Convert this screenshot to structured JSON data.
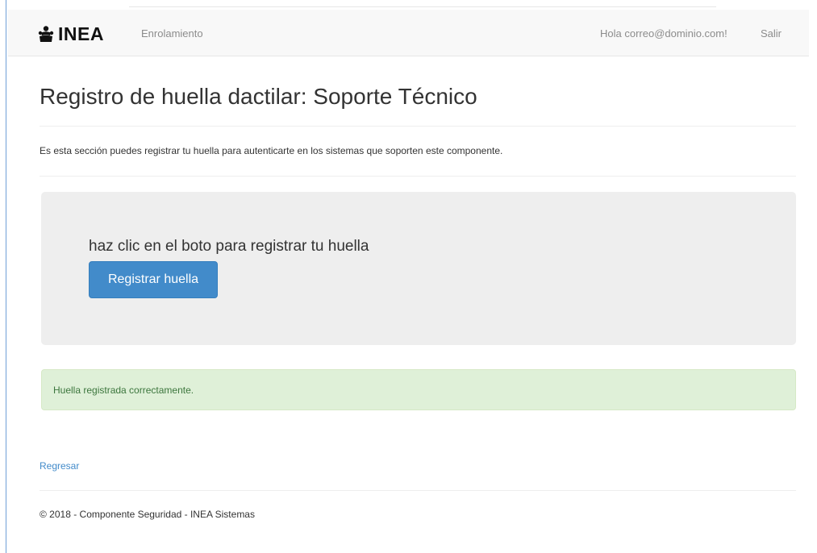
{
  "navbar": {
    "brand": "INEA",
    "brand_icon": "people-icon",
    "links": {
      "enrolamiento": "Enrolamiento",
      "user_greeting": "Hola correo@dominio.com!",
      "logout": "Salir"
    }
  },
  "main": {
    "title": "Registro de huella dactilar: Soporte Técnico",
    "description": "Es esta sección puedes registrar tu huella para autenticarte en los sistemas que soporten este componente.",
    "panel": {
      "instruction": "haz clic en el boto para registrar tu huella",
      "button_label": "Registrar huella"
    },
    "alert": {
      "message": "Huella registrada correctamente."
    },
    "back_link": "Regresar"
  },
  "footer": {
    "text": "© 2018 - Componente Seguridad - INEA Sistemas"
  },
  "colors": {
    "primary": "#428bca",
    "success_bg": "#dff0d8",
    "success_text": "#3c763d",
    "panel_bg": "#eeeeee",
    "navbar_bg": "#f8f8f8"
  }
}
